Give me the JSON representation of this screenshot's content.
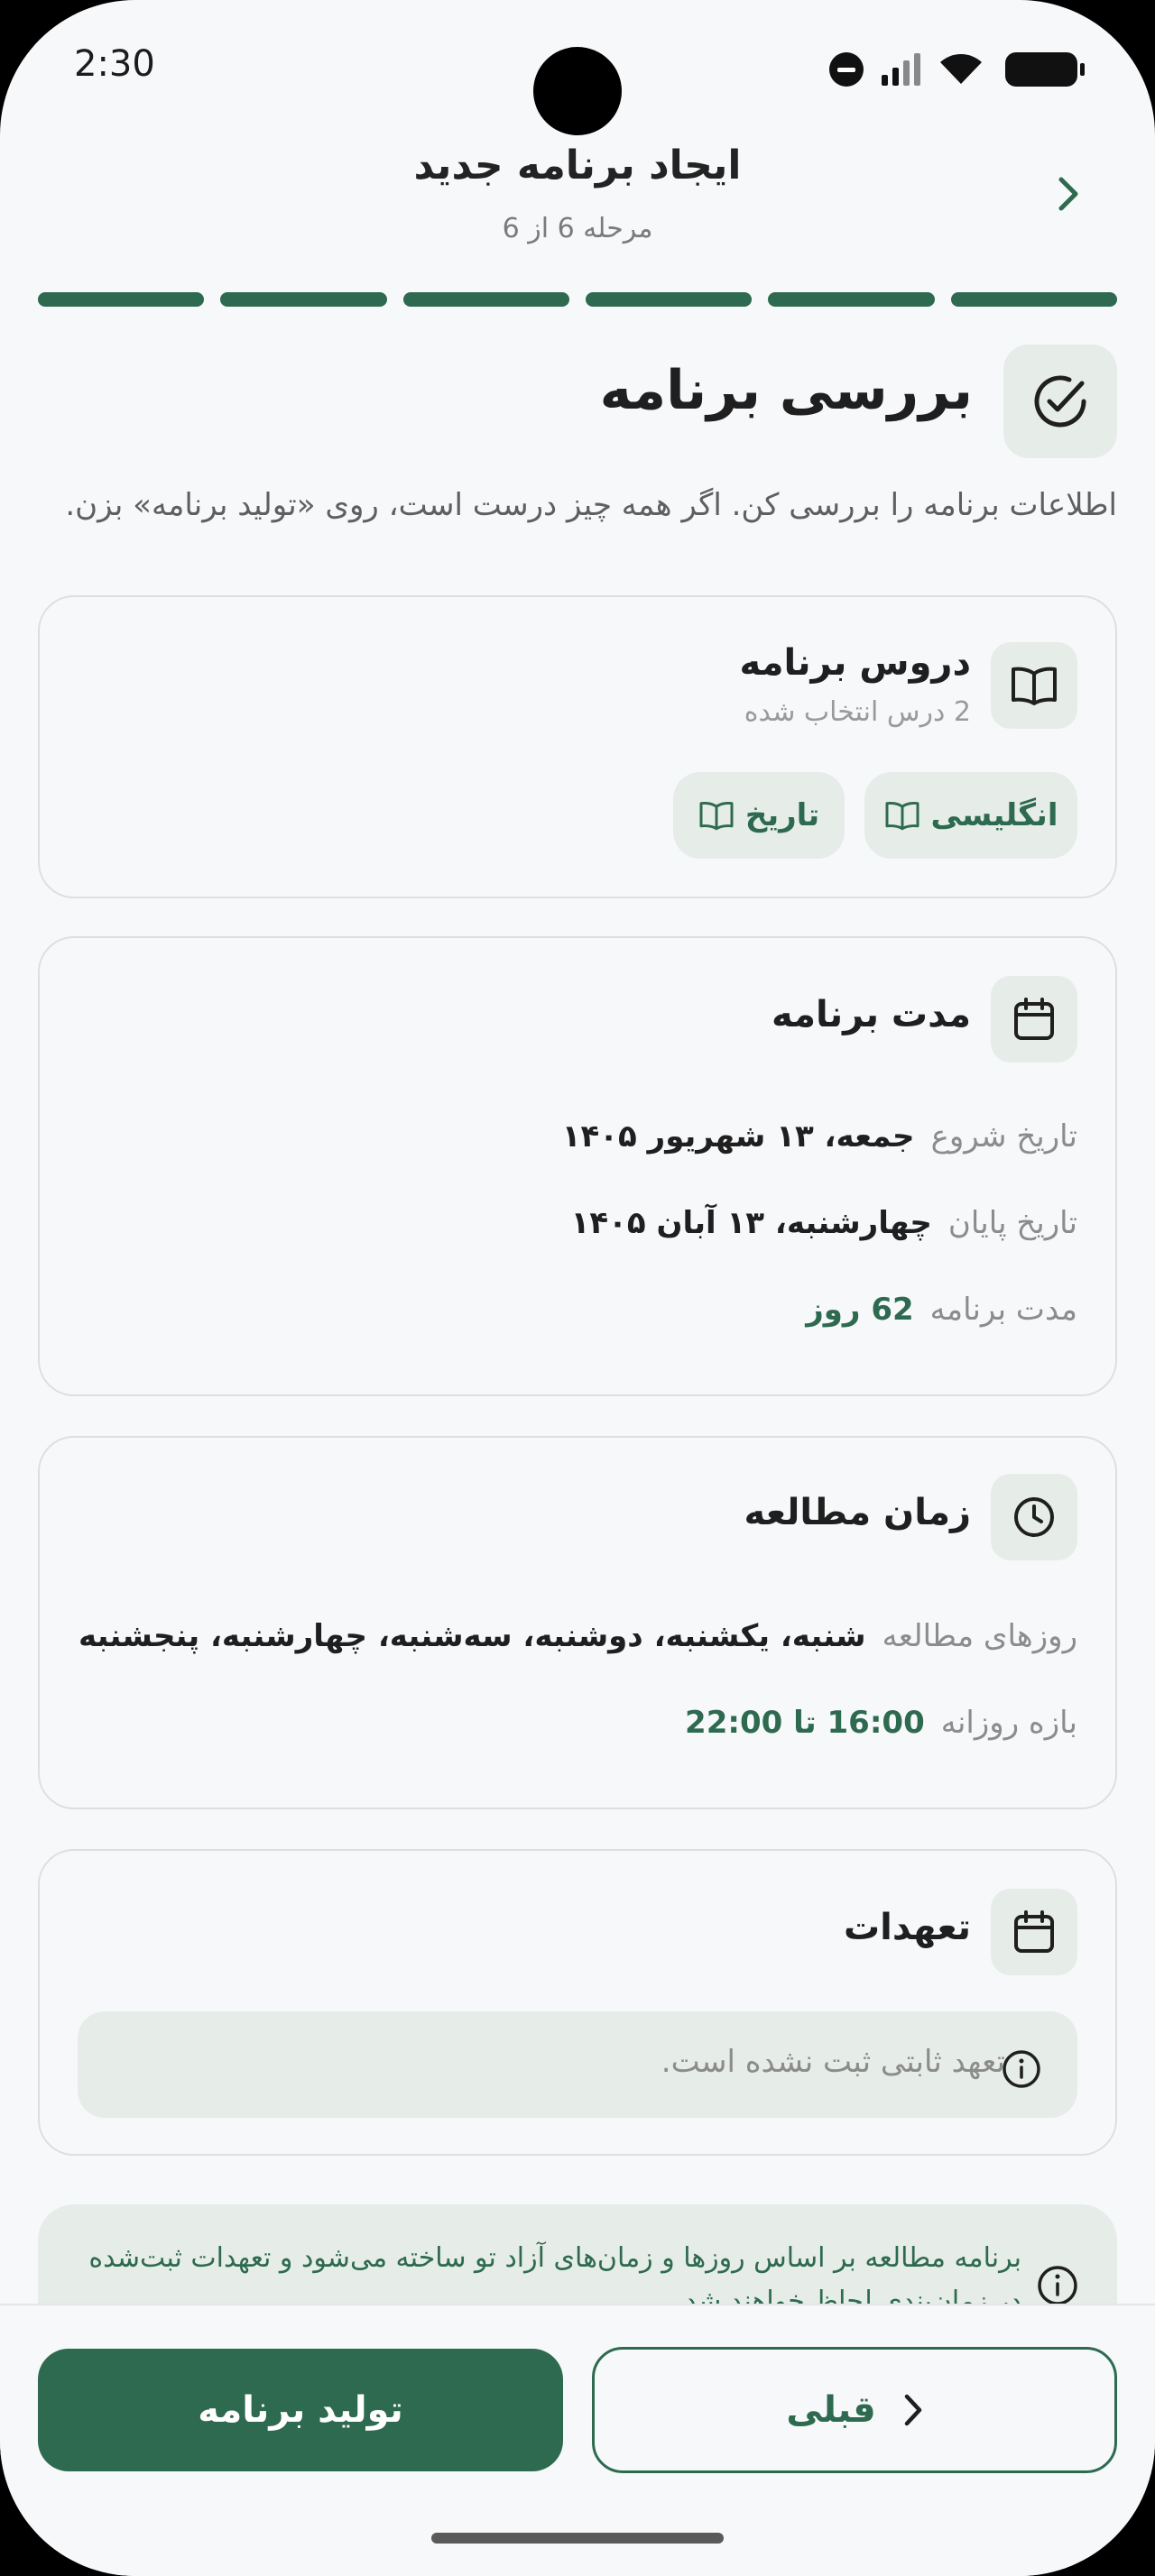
{
  "status_bar": {
    "time": "2:30"
  },
  "header": {
    "title": "ایجاد برنامه جدید",
    "step": "مرحله 6 از 6",
    "progress": {
      "completed_steps": 6,
      "total_steps": 6
    }
  },
  "section": {
    "title": "بررسی برنامه",
    "description": "اطلاعات برنامه را بررسی کن. اگر همه چیز درست است، روی «تولید برنامه» بزن."
  },
  "lessons_card": {
    "title": "دروس برنامه",
    "subtitle": "2 درس انتخاب شده",
    "chips": [
      "انگلیسی",
      "تاریخ"
    ]
  },
  "duration_card": {
    "title": "مدت برنامه",
    "rows": [
      {
        "label": "تاریخ شروع",
        "value": "جمعه، ۱۳ شهریور ۱۴۰۵"
      },
      {
        "label": "تاریخ پایان",
        "value": "چهارشنبه، ۱۳ آبان ۱۴۰۵"
      },
      {
        "label": "مدت برنامه",
        "value": "62 روز"
      }
    ]
  },
  "study_time_card": {
    "title": "زمان مطالعه",
    "rows": [
      {
        "label": "روزهای مطالعه",
        "value": "شنبه، یکشنبه، دوشنبه، سه‌شنبه، چهارشنبه، پنجشنبه"
      },
      {
        "label": "بازه روزانه",
        "value": "16:00 تا 22:00"
      }
    ]
  },
  "commitments_card": {
    "title": "تعهدات",
    "notice": "تعهد ثابتی ثبت نشده است."
  },
  "info_box": {
    "line1": "برنامه مطالعه بر اساس روزها و زمان‌های آزاد تو ساخته می‌شود و تعهدات ثبت‌شده",
    "line2": "در زمان‌بندی لحاظ خواهند شد."
  },
  "actions": {
    "generate_label": "تولید برنامه",
    "previous_label": "قبلی"
  },
  "colors": {
    "accent": "#2d6a4f",
    "accent_light": "#e6ece8",
    "background": "#f7f8fa"
  }
}
